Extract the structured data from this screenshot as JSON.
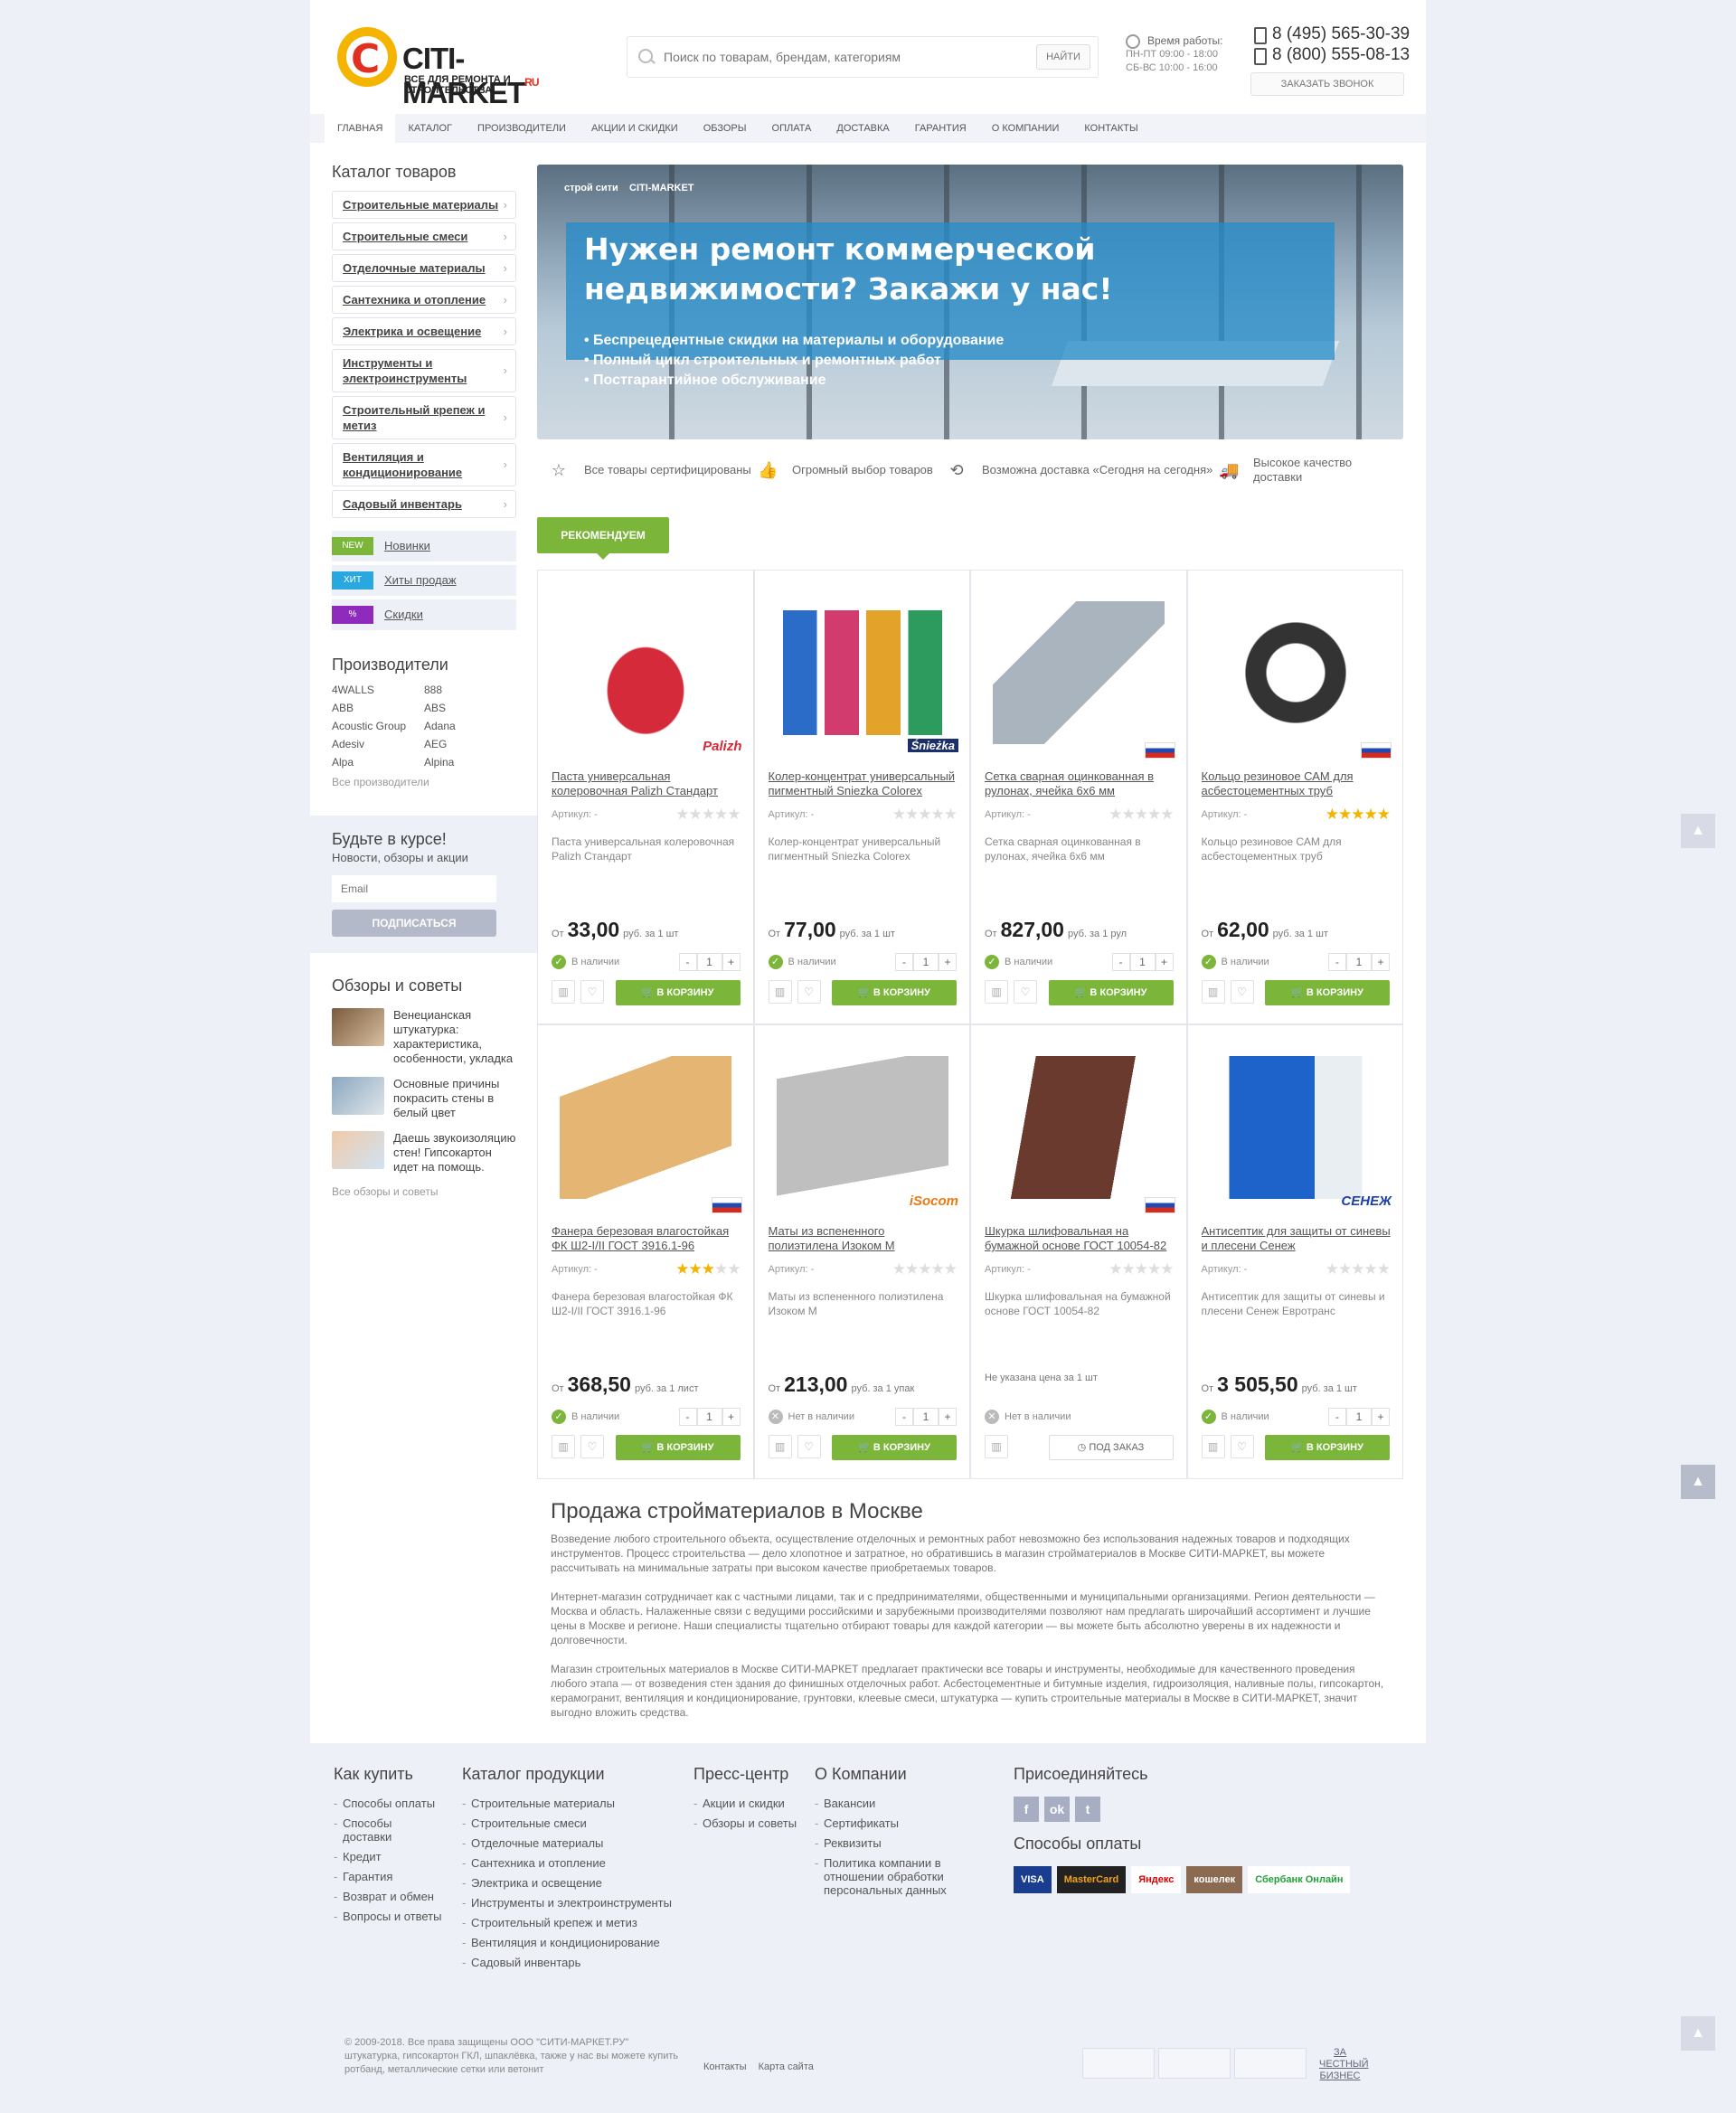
{
  "header": {
    "logo_text": "CITI-MARKET",
    "logo_ru": "RU",
    "logo_sub": "ВСЕ ДЛЯ РЕМОНТА И СТРОИТЕЛЬСТВА",
    "search_placeholder": "Поиск по товарам, брендам, категориям",
    "search_button": "НАЙТИ",
    "hours_title": "Время работы:",
    "hours_weekdays": "ПН-ПТ 09:00 - 18:00",
    "hours_weekend": "СБ-ВС 10:00 - 16:00",
    "phone1": "8 (495) 565-30-39",
    "phone2": "8 (800) 555-08-13",
    "callback": "ЗАКАЗАТЬ ЗВОНОК"
  },
  "nav": [
    "ГЛАВНАЯ",
    "КАТАЛОГ",
    "ПРОИЗВОДИТЕЛИ",
    "АКЦИИ И СКИДКИ",
    "ОБЗОРЫ",
    "ОПЛАТА",
    "ДОСТАВКА",
    "ГАРАНТИЯ",
    "О КОМПАНИИ",
    "КОНТАКТЫ"
  ],
  "sidebar": {
    "catalog_title": "Каталог товаров",
    "categories": [
      "Строительные материалы",
      "Строительные смеси",
      "Отделочные материалы",
      "Сантехника и отопление",
      "Электрика и освещение",
      "Инструменты и электроинструменты",
      "Строительный крепеж и метиз",
      "Вентиляция и кондиционирование",
      "Садовый инвентарь"
    ],
    "tags": [
      {
        "tag": "NEW",
        "label": "Новинки",
        "color": "#7bb63a"
      },
      {
        "tag": "ХИТ",
        "label": "Хиты продаж",
        "color": "#29a8e0"
      },
      {
        "tag": "%",
        "label": "Скидки",
        "color": "#8e2bbd"
      }
    ],
    "brands_title": "Производители",
    "brands": [
      "4WALLS",
      "888",
      "ABB",
      "ABS",
      "Acoustic Group",
      "Adana",
      "Adesiv",
      "AEG",
      "Alpa",
      "Alpina"
    ],
    "all_brands": "Все производители",
    "news_title": "Будьте в курсе!",
    "news_sub": "Новости, обзоры и акции",
    "email_placeholder": "Email",
    "subscribe": "ПОДПИСАТЬСЯ",
    "reviews_title": "Обзоры и советы",
    "reviews": [
      "Венецианская штукатурка: характеристика, особенности, укладка",
      "Основные причины покрасить стены в белый цвет",
      "Даешь звукоизоляцию стен! Гипсокартон идет на помощь."
    ],
    "all_reviews": "Все обзоры и советы"
  },
  "banner": {
    "logo1": "строй сити",
    "logo2": "CITI-MARKET",
    "title": "Нужен ремонт коммерческой недвижимости? Закажи у нас!",
    "points": [
      "Беспрецедентные скидки на материалы и оборудование",
      "Полный цикл строительных и ремонтных работ",
      "Постгарантийное обслуживание"
    ]
  },
  "features": [
    {
      "icon": "star-icon",
      "text": "Все товары сертифицированы"
    },
    {
      "icon": "thumbs-up-icon",
      "text": "Огромный выбор товаров"
    },
    {
      "icon": "clock-back-icon",
      "text": "Возможна доставка «Сегодня на сегодня»"
    },
    {
      "icon": "truck-icon",
      "text": "Высокое качество доставки"
    }
  ],
  "recommended_label": "РЕКОМЕНДУЕМ",
  "common": {
    "article": "Артикул: -",
    "from": "От",
    "in_stock": "В наличии",
    "out_of_stock": "Нет в наличии",
    "to_cart": "В КОРЗИНУ",
    "to_order": "ПОД ЗАКАЗ",
    "qty": "1"
  },
  "products": [
    {
      "name": "Паста универсальная колеровочная Palizh Стандарт",
      "desc": "Паста универсальная колеровочная Palizh Стандарт",
      "price": "33,00",
      "unit": "руб. за 1 шт",
      "rating": 0,
      "in_stock": true,
      "badge": "Palizh"
    },
    {
      "name": "Колер-концентрат универсальный пигментный Sniezka Colorex",
      "desc": "Колер-концентрат универсальный пигментный Sniezka Colorex",
      "price": "77,00",
      "unit": "руб. за 1 шт",
      "rating": 0,
      "in_stock": true,
      "badge": "Śnieżka"
    },
    {
      "name": "Сетка сварная оцинкованная в рулонах, ячейка 6х6 мм",
      "desc": "Сетка сварная оцинкованная в рулонах, ячейка 6х6 мм",
      "price": "827,00",
      "unit": "руб. за 1 рул",
      "rating": 0,
      "in_stock": true,
      "badge": "flag"
    },
    {
      "name": "Кольцо резиновое САМ для асбестоцементных труб",
      "desc": "Кольцо резиновое САМ для асбестоцементных труб",
      "price": "62,00",
      "unit": "руб. за 1 шт",
      "rating": 5,
      "in_stock": true,
      "badge": "flag"
    },
    {
      "name": "Фанера березовая влагостойкая ФК Ш2-I/II ГОСТ 3916.1-96",
      "desc": "Фанера березовая влагостойкая ФК Ш2-I/II ГОСТ 3916.1-96",
      "price": "368,50",
      "unit": "руб. за 1 лист",
      "rating": 3,
      "in_stock": true,
      "badge": "flag"
    },
    {
      "name": "Маты из вспененного полиэтилена Изоком М",
      "desc": "Маты из вспененного полиэтилена Изоком М",
      "price": "213,00",
      "unit": "руб. за 1 упак",
      "rating": 0,
      "in_stock": false,
      "badge": "iSocom"
    },
    {
      "name": "Шкурка шлифовальная на бумажной основе ГОСТ 10054-82",
      "desc": "Шкурка шлифовальная на бумажной основе ГОСТ 10054-82",
      "price": "",
      "unit": "Не указана цена за 1 шт",
      "rating": 0,
      "in_stock": false,
      "badge": "flag"
    },
    {
      "name": "Антисептик для защиты от синевы и плесени Сенеж",
      "desc": "Антисептик для защиты от синевы и плесени Сенеж Евротранс",
      "price": "3 505,50",
      "unit": "руб. за 1 шт",
      "rating": 0,
      "in_stock": true,
      "badge": "СЕНЕЖ"
    }
  ],
  "seo": {
    "title": "Продажа стройматериалов в Москве",
    "p1": "Возведение любого строительного объекта, осуществление отделочных и ремонтных работ невозможно без использования надежных товаров и подходящих инструментов. Процесс строительства — дело хлопотное и затратное, но обратившись в магазин стройматериалов в Москве СИТИ-МАРКЕТ, вы можете рассчитывать на минимальные затраты при высоком качестве приобретаемых товаров.",
    "p2": "Интернет-магазин сотрудничает как с частными лицами, так и с предпринимателями, общественными и муниципальными организациями. Регион деятельности — Москва и область. Налаженные связи с ведущими российскими и зарубежными производителями позволяют нам предлагать широчайший ассортимент и лучшие цены в Москве и регионе. Наши специалисты тщательно отбирают товары для каждой категории — вы можете быть абсолютно уверены в их надежности и долговечности.",
    "p3": "Магазин строительных материалов в Москве СИТИ-МАРКЕТ предлагает практически все товары и инструменты, необходимые для качественного проведения любого этапа — от возведения стен здания до финишных отделочных работ. Асбестоцементные и битумные изделия, гидроизоляция, наливные полы, гипсокартон, керамогранит, вентиляция и кондиционирование, грунтовки, клеевые смеси, штукатурка — купить строительные материалы в Москве в СИТИ-МАРКЕТ, значит выгодно вложить средства."
  },
  "footer": {
    "how_to_buy_title": "Как купить",
    "how_to_buy": [
      "Способы оплаты",
      "Способы доставки",
      "Кредит",
      "Гарантия",
      "Возврат и обмен",
      "Вопросы и ответы"
    ],
    "catalog_title": "Каталог продукции",
    "catalog": [
      "Строительные материалы",
      "Строительные смеси",
      "Отделочные материалы",
      "Сантехника и отопление",
      "Электрика и освещение",
      "Инструменты и электроинструменты",
      "Строительный крепеж и метиз",
      "Вентиляция и кондиционирование",
      "Садовый инвентарь"
    ],
    "press_title": "Пресс-центр",
    "press": [
      "Акции и скидки",
      "Обзоры и советы"
    ],
    "company_title": "О Компании",
    "company": [
      "Вакансии",
      "Сертификаты",
      "Реквизиты",
      "Политика компании в отношении обработки персональных данных"
    ],
    "join_title": "Присоединяйтесь",
    "social": [
      "f",
      "ok",
      "t"
    ],
    "payment_title": "Способы оплаты",
    "payments": [
      "VISA",
      "MasterCard",
      "Яндекс",
      "кошелек",
      "Сбербанк Онлайн"
    ],
    "copyright": "© 2009-2018. Все права защищены ООО \"СИТИ-МАРКЕТ.РУ\"",
    "copyright_sub": "штукатурка, гипсокартон ГКЛ, шпаклёвка, также у нас вы можете купить ротбанд, металлические сетки или ветонит",
    "contacts": "Контакты",
    "sitemap": "Карта сайта",
    "honest": "ЗА ЧЕСТНЫЙ БИЗНЕС"
  }
}
